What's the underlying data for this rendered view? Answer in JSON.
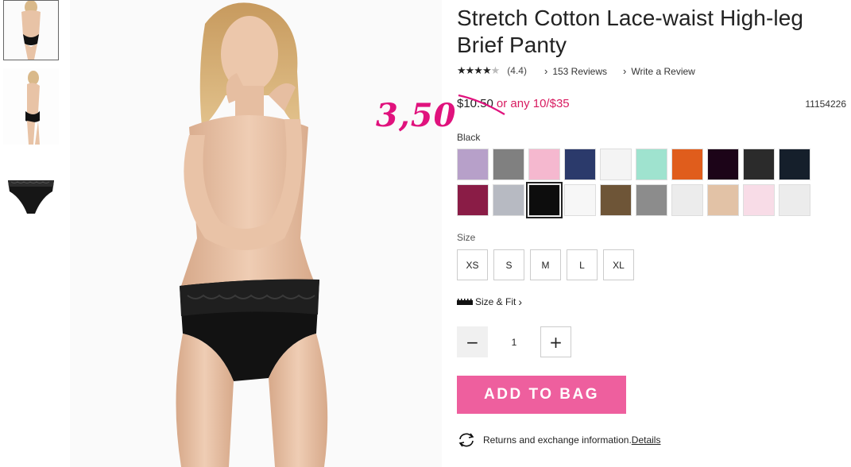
{
  "product": {
    "title": "Stretch Cotton Lace-waist High-leg Brief Panty",
    "rating_value": "(4.4)",
    "reviews_count": "153 Reviews",
    "write_review": "Write a Review",
    "stars": 4.4,
    "price_original": "$10.50",
    "price_offer": "or any 10/$35",
    "handwritten_price": "3,50",
    "sku": "11154226"
  },
  "color": {
    "label": "Black",
    "swatches": [
      {
        "name": "lavender",
        "color": "#b7a0c9"
      },
      {
        "name": "grey-lace",
        "color": "#808080"
      },
      {
        "name": "pink-stripe",
        "color": "#f5b8cf"
      },
      {
        "name": "navy",
        "color": "#2b3a6b"
      },
      {
        "name": "white",
        "color": "#f4f4f4"
      },
      {
        "name": "mint",
        "color": "#9fe3cf"
      },
      {
        "name": "orange",
        "color": "#e05d1c"
      },
      {
        "name": "black-plum",
        "color": "#1c0418"
      },
      {
        "name": "black-polka-dot",
        "color": "#2b2b2b"
      },
      {
        "name": "black-script",
        "color": "#151f2b"
      },
      {
        "name": "berry",
        "color": "#8a1c46"
      },
      {
        "name": "heather-grey",
        "color": "#b7bac2"
      },
      {
        "name": "black",
        "color": "#0d0d0d"
      },
      {
        "name": "white-script",
        "color": "#f7f7f7"
      },
      {
        "name": "leopard",
        "color": "#6e5537"
      },
      {
        "name": "black-white-stripe",
        "color": "#8c8c8c"
      },
      {
        "name": "white-print",
        "color": "#ececec"
      },
      {
        "name": "nude-lace",
        "color": "#e2c2a6"
      },
      {
        "name": "pink-white",
        "color": "#f8dce7"
      },
      {
        "name": "white-stripe",
        "color": "#ececec"
      }
    ],
    "selected_index": 12
  },
  "size": {
    "label": "Size",
    "options": [
      "XS",
      "S",
      "M",
      "L",
      "XL"
    ],
    "size_fit": "Size & Fit"
  },
  "quantity": {
    "value": "1",
    "minus": "−",
    "plus": "+"
  },
  "actions": {
    "add_to_bag": "ADD TO BAG",
    "returns_text": "Returns and exchange information.",
    "details_link": "Details"
  },
  "colors": {
    "accent_pink": "#ee5f9e",
    "offer_pink": "#d81b60",
    "handwritten_magenta": "#e0127d"
  }
}
